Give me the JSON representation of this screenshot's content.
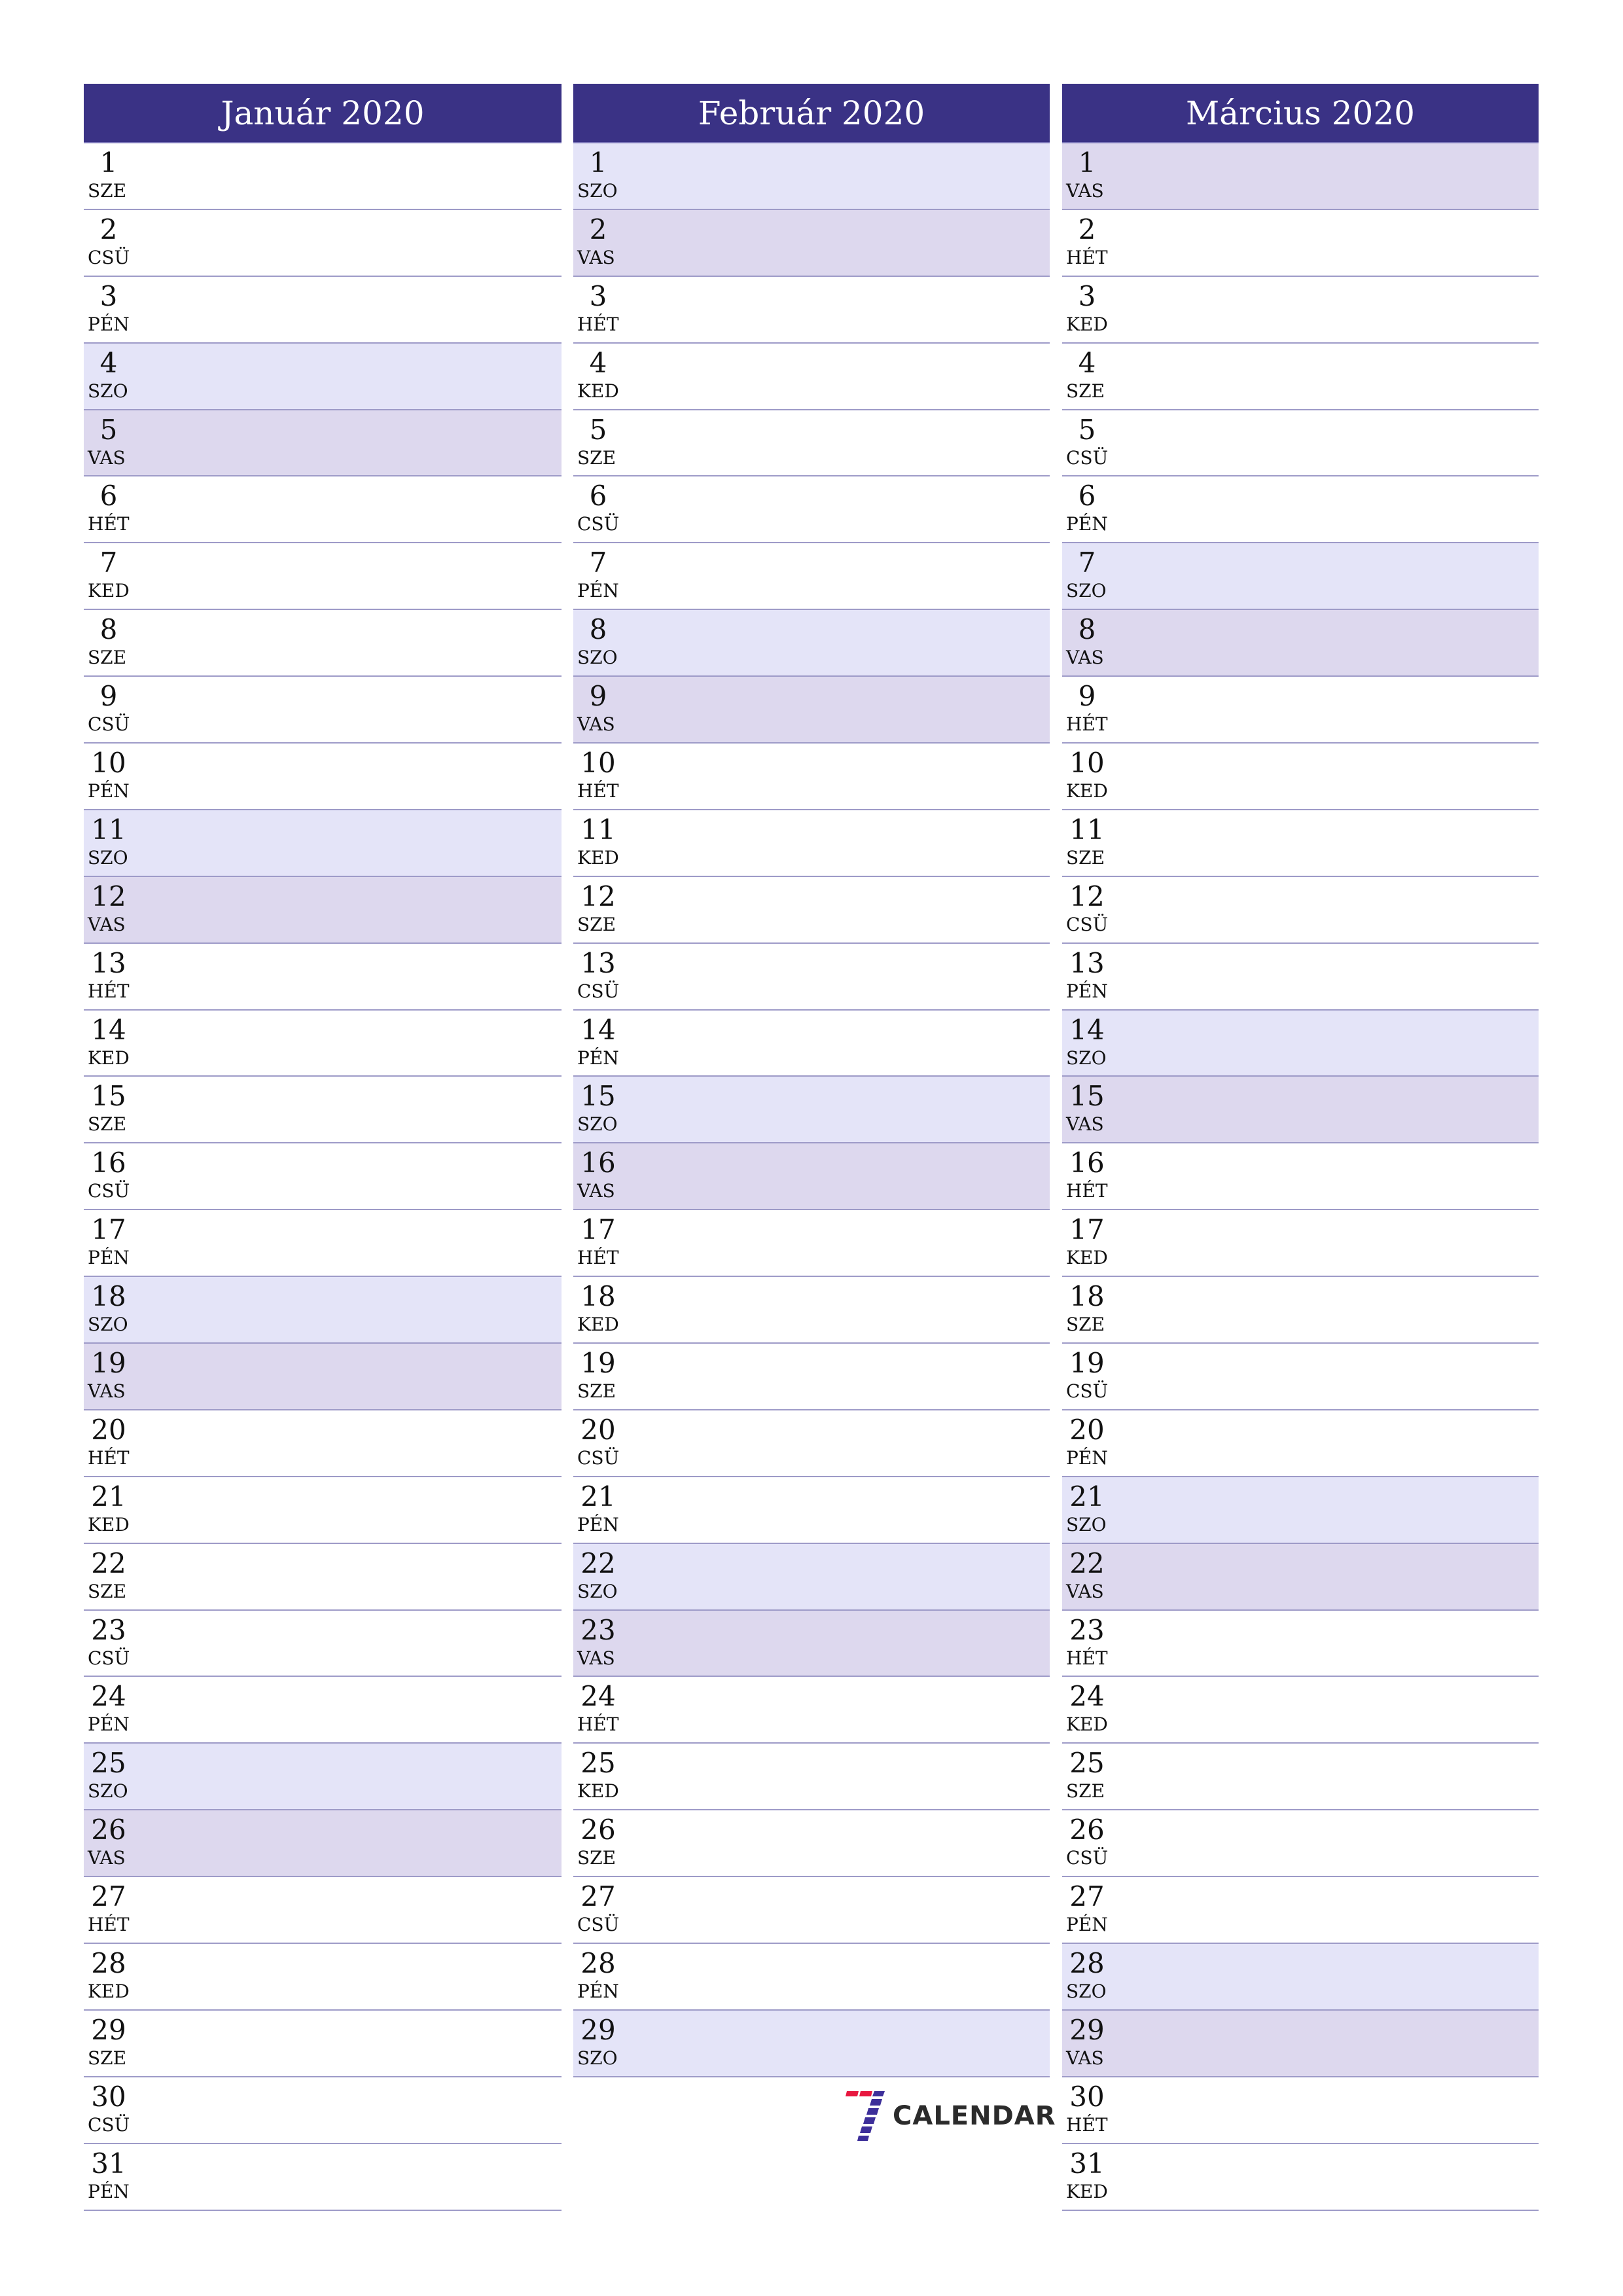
{
  "colors": {
    "header": "#3a3285",
    "saturday": "#e4e4f8",
    "sunday": "#ddd8ee",
    "separator": "#9e9bc8",
    "logo_red": "#e8173f",
    "logo_blue": "#3d2f9a"
  },
  "months": [
    {
      "title": "Január 2020",
      "days": [
        {
          "n": "1",
          "d": "SZE"
        },
        {
          "n": "2",
          "d": "CSÜ"
        },
        {
          "n": "3",
          "d": "PÉN"
        },
        {
          "n": "4",
          "d": "SZO",
          "w": "sat"
        },
        {
          "n": "5",
          "d": "VAS",
          "w": "sun"
        },
        {
          "n": "6",
          "d": "HÉT"
        },
        {
          "n": "7",
          "d": "KED"
        },
        {
          "n": "8",
          "d": "SZE"
        },
        {
          "n": "9",
          "d": "CSÜ"
        },
        {
          "n": "10",
          "d": "PÉN"
        },
        {
          "n": "11",
          "d": "SZO",
          "w": "sat"
        },
        {
          "n": "12",
          "d": "VAS",
          "w": "sun"
        },
        {
          "n": "13",
          "d": "HÉT"
        },
        {
          "n": "14",
          "d": "KED"
        },
        {
          "n": "15",
          "d": "SZE"
        },
        {
          "n": "16",
          "d": "CSÜ"
        },
        {
          "n": "17",
          "d": "PÉN"
        },
        {
          "n": "18",
          "d": "SZO",
          "w": "sat"
        },
        {
          "n": "19",
          "d": "VAS",
          "w": "sun"
        },
        {
          "n": "20",
          "d": "HÉT"
        },
        {
          "n": "21",
          "d": "KED"
        },
        {
          "n": "22",
          "d": "SZE"
        },
        {
          "n": "23",
          "d": "CSÜ"
        },
        {
          "n": "24",
          "d": "PÉN"
        },
        {
          "n": "25",
          "d": "SZO",
          "w": "sat"
        },
        {
          "n": "26",
          "d": "VAS",
          "w": "sun"
        },
        {
          "n": "27",
          "d": "HÉT"
        },
        {
          "n": "28",
          "d": "KED"
        },
        {
          "n": "29",
          "d": "SZE"
        },
        {
          "n": "30",
          "d": "CSÜ"
        },
        {
          "n": "31",
          "d": "PÉN"
        }
      ]
    },
    {
      "title": "Február 2020",
      "days": [
        {
          "n": "1",
          "d": "SZO",
          "w": "sat"
        },
        {
          "n": "2",
          "d": "VAS",
          "w": "sun"
        },
        {
          "n": "3",
          "d": "HÉT"
        },
        {
          "n": "4",
          "d": "KED"
        },
        {
          "n": "5",
          "d": "SZE"
        },
        {
          "n": "6",
          "d": "CSÜ"
        },
        {
          "n": "7",
          "d": "PÉN"
        },
        {
          "n": "8",
          "d": "SZO",
          "w": "sat"
        },
        {
          "n": "9",
          "d": "VAS",
          "w": "sun"
        },
        {
          "n": "10",
          "d": "HÉT"
        },
        {
          "n": "11",
          "d": "KED"
        },
        {
          "n": "12",
          "d": "SZE"
        },
        {
          "n": "13",
          "d": "CSÜ"
        },
        {
          "n": "14",
          "d": "PÉN"
        },
        {
          "n": "15",
          "d": "SZO",
          "w": "sat"
        },
        {
          "n": "16",
          "d": "VAS",
          "w": "sun"
        },
        {
          "n": "17",
          "d": "HÉT"
        },
        {
          "n": "18",
          "d": "KED"
        },
        {
          "n": "19",
          "d": "SZE"
        },
        {
          "n": "20",
          "d": "CSÜ"
        },
        {
          "n": "21",
          "d": "PÉN"
        },
        {
          "n": "22",
          "d": "SZO",
          "w": "sat"
        },
        {
          "n": "23",
          "d": "VAS",
          "w": "sun"
        },
        {
          "n": "24",
          "d": "HÉT"
        },
        {
          "n": "25",
          "d": "KED"
        },
        {
          "n": "26",
          "d": "SZE"
        },
        {
          "n": "27",
          "d": "CSÜ"
        },
        {
          "n": "28",
          "d": "PÉN"
        },
        {
          "n": "29",
          "d": "SZO",
          "w": "sat"
        }
      ]
    },
    {
      "title": "Március 2020",
      "days": [
        {
          "n": "1",
          "d": "VAS",
          "w": "sun"
        },
        {
          "n": "2",
          "d": "HÉT"
        },
        {
          "n": "3",
          "d": "KED"
        },
        {
          "n": "4",
          "d": "SZE"
        },
        {
          "n": "5",
          "d": "CSÜ"
        },
        {
          "n": "6",
          "d": "PÉN"
        },
        {
          "n": "7",
          "d": "SZO",
          "w": "sat"
        },
        {
          "n": "8",
          "d": "VAS",
          "w": "sun"
        },
        {
          "n": "9",
          "d": "HÉT"
        },
        {
          "n": "10",
          "d": "KED"
        },
        {
          "n": "11",
          "d": "SZE"
        },
        {
          "n": "12",
          "d": "CSÜ"
        },
        {
          "n": "13",
          "d": "PÉN"
        },
        {
          "n": "14",
          "d": "SZO",
          "w": "sat"
        },
        {
          "n": "15",
          "d": "VAS",
          "w": "sun"
        },
        {
          "n": "16",
          "d": "HÉT"
        },
        {
          "n": "17",
          "d": "KED"
        },
        {
          "n": "18",
          "d": "SZE"
        },
        {
          "n": "19",
          "d": "CSÜ"
        },
        {
          "n": "20",
          "d": "PÉN"
        },
        {
          "n": "21",
          "d": "SZO",
          "w": "sat"
        },
        {
          "n": "22",
          "d": "VAS",
          "w": "sun"
        },
        {
          "n": "23",
          "d": "HÉT"
        },
        {
          "n": "24",
          "d": "KED"
        },
        {
          "n": "25",
          "d": "SZE"
        },
        {
          "n": "26",
          "d": "CSÜ"
        },
        {
          "n": "27",
          "d": "PÉN"
        },
        {
          "n": "28",
          "d": "SZO",
          "w": "sat"
        },
        {
          "n": "29",
          "d": "VAS",
          "w": "sun"
        },
        {
          "n": "30",
          "d": "HÉT"
        },
        {
          "n": "31",
          "d": "KED"
        }
      ]
    }
  ],
  "logo": {
    "text": "CALENDAR",
    "icon": "seven-icon"
  }
}
